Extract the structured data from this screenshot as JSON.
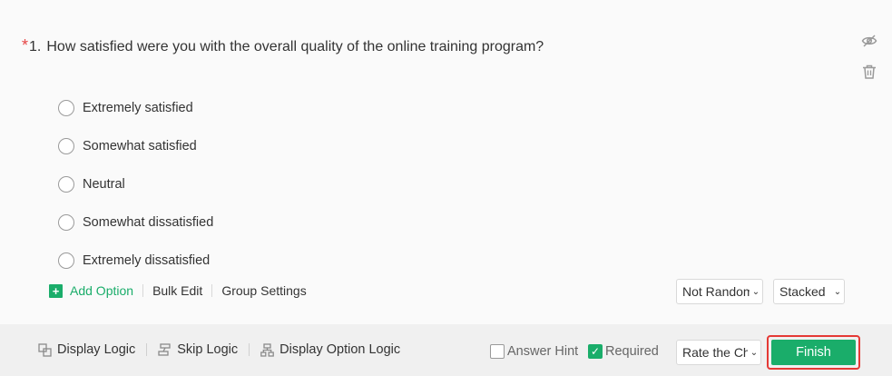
{
  "question": {
    "required_mark": "*",
    "number": "1.",
    "text": "How satisfied were you with the overall quality of the online training program?"
  },
  "side_icons": [
    "eye-slash-icon",
    "trash-icon"
  ],
  "options": [
    {
      "label": "Extremely satisfied"
    },
    {
      "label": "Somewhat satisfied"
    },
    {
      "label": "Neutral"
    },
    {
      "label": "Somewhat dissatisfied"
    },
    {
      "label": "Extremely dissatisfied"
    }
  ],
  "actions": {
    "add_option": "Add Option",
    "add_icon": "+",
    "bulk_edit": "Bulk Edit",
    "group_settings": "Group Settings"
  },
  "selects": {
    "randomization": "Not Random",
    "layout": "Stacked",
    "rate": "Rate the Ch"
  },
  "footer": {
    "display_logic": "Display Logic",
    "skip_logic": "Skip Logic",
    "display_option_logic": "Display Option Logic",
    "answer_hint": "Answer Hint",
    "answer_hint_checked": false,
    "required": "Required",
    "required_checked": true,
    "finish": "Finish"
  },
  "colors": {
    "accent": "#1aad6a",
    "required_star": "#e64545",
    "highlight_border": "#e53935"
  }
}
